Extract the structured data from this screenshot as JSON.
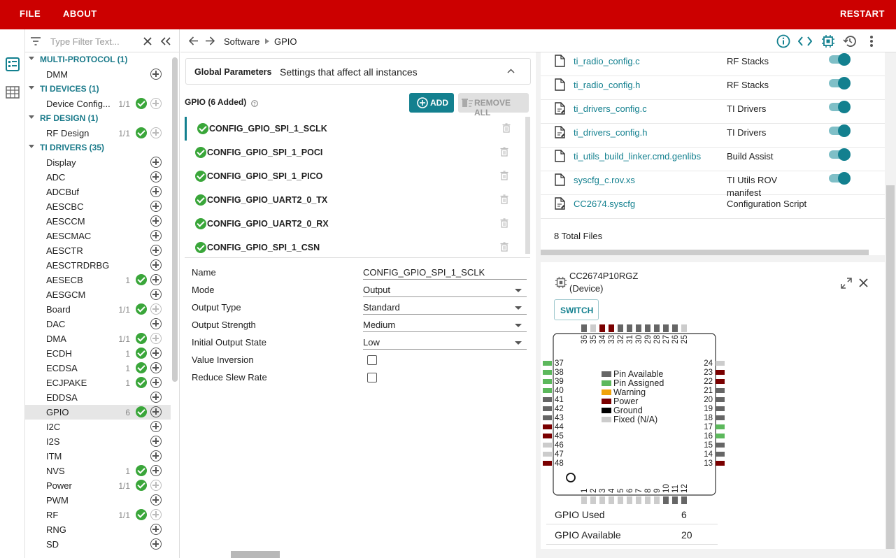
{
  "menu": {
    "file": "FILE",
    "about": "ABOUT",
    "restart": "RESTART"
  },
  "filter": {
    "placeholder": "Type Filter Text..."
  },
  "breadcrumb": {
    "parent": "Software",
    "current": "GPIO"
  },
  "tree": [
    {
      "type": "cat",
      "label": "MULTI-PROTOCOL (1)"
    },
    {
      "type": "item",
      "label": "DMM",
      "count": "",
      "check": false,
      "plus": "on"
    },
    {
      "type": "cat",
      "label": "TI DEVICES (1)"
    },
    {
      "type": "item",
      "label": "Device Config...",
      "count": "1/1",
      "check": true,
      "plus": "off"
    },
    {
      "type": "cat",
      "label": "RF DESIGN (1)"
    },
    {
      "type": "item",
      "label": "RF Design",
      "count": "1/1",
      "check": true,
      "plus": "off"
    },
    {
      "type": "cat",
      "label": "TI DRIVERS (35)"
    },
    {
      "type": "item",
      "label": "Display",
      "count": "",
      "check": false,
      "plus": "on"
    },
    {
      "type": "item",
      "label": "ADC",
      "count": "",
      "check": false,
      "plus": "on"
    },
    {
      "type": "item",
      "label": "ADCBuf",
      "count": "",
      "check": false,
      "plus": "on"
    },
    {
      "type": "item",
      "label": "AESCBC",
      "count": "",
      "check": false,
      "plus": "on"
    },
    {
      "type": "item",
      "label": "AESCCM",
      "count": "",
      "check": false,
      "plus": "on"
    },
    {
      "type": "item",
      "label": "AESCMAC",
      "count": "",
      "check": false,
      "plus": "on"
    },
    {
      "type": "item",
      "label": "AESCTR",
      "count": "",
      "check": false,
      "plus": "on"
    },
    {
      "type": "item",
      "label": "AESCTRDRBG",
      "count": "",
      "check": false,
      "plus": "on"
    },
    {
      "type": "item",
      "label": "AESECB",
      "count": "1",
      "check": true,
      "plus": "on"
    },
    {
      "type": "item",
      "label": "AESGCM",
      "count": "",
      "check": false,
      "plus": "on"
    },
    {
      "type": "item",
      "label": "Board",
      "count": "1/1",
      "check": true,
      "plus": "off"
    },
    {
      "type": "item",
      "label": "DAC",
      "count": "",
      "check": false,
      "plus": "on"
    },
    {
      "type": "item",
      "label": "DMA",
      "count": "1/1",
      "check": true,
      "plus": "off"
    },
    {
      "type": "item",
      "label": "ECDH",
      "count": "1",
      "check": true,
      "plus": "on"
    },
    {
      "type": "item",
      "label": "ECDSA",
      "count": "1",
      "check": true,
      "plus": "on"
    },
    {
      "type": "item",
      "label": "ECJPAKE",
      "count": "1",
      "check": true,
      "plus": "on"
    },
    {
      "type": "item",
      "label": "EDDSA",
      "count": "",
      "check": false,
      "plus": "on"
    },
    {
      "type": "item",
      "label": "GPIO",
      "count": "6",
      "check": true,
      "plus": "on",
      "selected": true
    },
    {
      "type": "item",
      "label": "I2C",
      "count": "",
      "check": false,
      "plus": "on"
    },
    {
      "type": "item",
      "label": "I2S",
      "count": "",
      "check": false,
      "plus": "on"
    },
    {
      "type": "item",
      "label": "ITM",
      "count": "",
      "check": false,
      "plus": "on"
    },
    {
      "type": "item",
      "label": "NVS",
      "count": "1",
      "check": true,
      "plus": "on"
    },
    {
      "type": "item",
      "label": "Power",
      "count": "1/1",
      "check": true,
      "plus": "off"
    },
    {
      "type": "item",
      "label": "PWM",
      "count": "",
      "check": false,
      "plus": "on"
    },
    {
      "type": "item",
      "label": "RF",
      "count": "1/1",
      "check": true,
      "plus": "off"
    },
    {
      "type": "item",
      "label": "RNG",
      "count": "",
      "check": false,
      "plus": "on"
    },
    {
      "type": "item",
      "label": "SD",
      "count": "",
      "check": false,
      "plus": "on"
    }
  ],
  "global": {
    "title": "Global Parameters",
    "desc": "Settings that affect all instances"
  },
  "gpio": {
    "header": "GPIO (6 Added)",
    "add": "ADD",
    "remove_all": "REMOVE ALL",
    "instances": [
      "CONFIG_GPIO_SPI_1_SCLK",
      "CONFIG_GPIO_SPI_1_POCI",
      "CONFIG_GPIO_SPI_1_PICO",
      "CONFIG_GPIO_UART2_0_TX",
      "CONFIG_GPIO_UART2_0_RX",
      "CONFIG_GPIO_SPI_1_CSN"
    ]
  },
  "props": [
    {
      "label": "Name",
      "value": "CONFIG_GPIO_SPI_1_SCLK",
      "kind": "text"
    },
    {
      "label": "Mode",
      "value": "Output",
      "kind": "select"
    },
    {
      "label": "Output Type",
      "value": "Standard",
      "kind": "select"
    },
    {
      "label": "Output Strength",
      "value": "Medium",
      "kind": "select"
    },
    {
      "label": "Initial Output State",
      "value": "Low",
      "kind": "select"
    },
    {
      "label": "Value Inversion",
      "value": "",
      "kind": "checkbox"
    },
    {
      "label": "Reduce Slew Rate",
      "value": "",
      "kind": "checkbox"
    }
  ],
  "files": [
    {
      "name": "ti_radio_config.c",
      "category": "RF Stacks",
      "icon": "file-icon"
    },
    {
      "name": "ti_radio_config.h",
      "category": "RF Stacks",
      "icon": "file-icon"
    },
    {
      "name": "ti_drivers_config.c",
      "category": "TI Drivers",
      "icon": "file-edit-icon"
    },
    {
      "name": "ti_drivers_config.h",
      "category": "TI Drivers",
      "icon": "file-edit-icon"
    },
    {
      "name": "ti_utils_build_linker.cmd.genlibs",
      "category": "Build Assist",
      "icon": "file-icon"
    },
    {
      "name": "syscfg_c.rov.xs",
      "category": "TI Utils ROV manifest",
      "icon": "file-icon"
    },
    {
      "name": "CC2674.syscfg",
      "category": "Configuration Script",
      "icon": "file-edit-icon",
      "no_toggle": true
    }
  ],
  "files_total": "8 Total Files",
  "device": {
    "name": "CC2674P10RGZ",
    "sub": "(Device)",
    "switch": "SWITCH",
    "legend": [
      {
        "label": "Pin Available",
        "color": "#666666"
      },
      {
        "label": "Pin Assigned",
        "color": "#5cb85c"
      },
      {
        "label": "Warning",
        "color": "#f0a30a"
      },
      {
        "label": "Power",
        "color": "#7a0000"
      },
      {
        "label": "Ground",
        "color": "#000000"
      },
      {
        "label": "Fixed (N/A)",
        "color": "#cccccc"
      }
    ],
    "pins_top": [
      {
        "n": "36",
        "c": "#666666"
      },
      {
        "n": "35",
        "c": "#cccccc"
      },
      {
        "n": "34",
        "c": "#7a0000"
      },
      {
        "n": "33",
        "c": "#7a0000"
      },
      {
        "n": "32",
        "c": "#666666"
      },
      {
        "n": "31",
        "c": "#666666"
      },
      {
        "n": "30",
        "c": "#666666"
      },
      {
        "n": "29",
        "c": "#666666"
      },
      {
        "n": "28",
        "c": "#666666"
      },
      {
        "n": "27",
        "c": "#666666"
      },
      {
        "n": "26",
        "c": "#666666"
      },
      {
        "n": "25",
        "c": "#cccccc"
      }
    ],
    "pins_left": [
      {
        "n": "37",
        "c": "#5cb85c"
      },
      {
        "n": "38",
        "c": "#5cb85c"
      },
      {
        "n": "39",
        "c": "#5cb85c"
      },
      {
        "n": "40",
        "c": "#5cb85c"
      },
      {
        "n": "41",
        "c": "#666666"
      },
      {
        "n": "42",
        "c": "#666666"
      },
      {
        "n": "43",
        "c": "#666666"
      },
      {
        "n": "44",
        "c": "#7a0000"
      },
      {
        "n": "45",
        "c": "#7a0000"
      },
      {
        "n": "46",
        "c": "#cccccc"
      },
      {
        "n": "47",
        "c": "#cccccc"
      },
      {
        "n": "48",
        "c": "#7a0000"
      }
    ],
    "pins_right": [
      {
        "n": "24",
        "c": "#cccccc"
      },
      {
        "n": "23",
        "c": "#7a0000"
      },
      {
        "n": "22",
        "c": "#7a0000"
      },
      {
        "n": "21",
        "c": "#666666"
      },
      {
        "n": "20",
        "c": "#666666"
      },
      {
        "n": "19",
        "c": "#666666"
      },
      {
        "n": "18",
        "c": "#666666"
      },
      {
        "n": "17",
        "c": "#5cb85c"
      },
      {
        "n": "16",
        "c": "#5cb85c"
      },
      {
        "n": "15",
        "c": "#666666"
      },
      {
        "n": "14",
        "c": "#666666"
      },
      {
        "n": "13",
        "c": "#7a0000"
      }
    ],
    "pins_bottom": [
      {
        "n": "1",
        "c": "#cccccc"
      },
      {
        "n": "2",
        "c": "#cccccc"
      },
      {
        "n": "3",
        "c": "#cccccc"
      },
      {
        "n": "4",
        "c": "#cccccc"
      },
      {
        "n": "5",
        "c": "#cccccc"
      },
      {
        "n": "6",
        "c": "#cccccc"
      },
      {
        "n": "7",
        "c": "#cccccc"
      },
      {
        "n": "8",
        "c": "#cccccc"
      },
      {
        "n": "9",
        "c": "#cccccc"
      },
      {
        "n": "10",
        "c": "#666666"
      },
      {
        "n": "11",
        "c": "#666666"
      },
      {
        "n": "12",
        "c": "#666666"
      }
    ]
  },
  "stats": [
    {
      "label": "GPIO Used",
      "value": "6"
    },
    {
      "label": "GPIO Available",
      "value": "20"
    }
  ],
  "colors": {
    "brand": "#cc0000",
    "accent": "#13808f",
    "ok": "#3aa63a"
  }
}
